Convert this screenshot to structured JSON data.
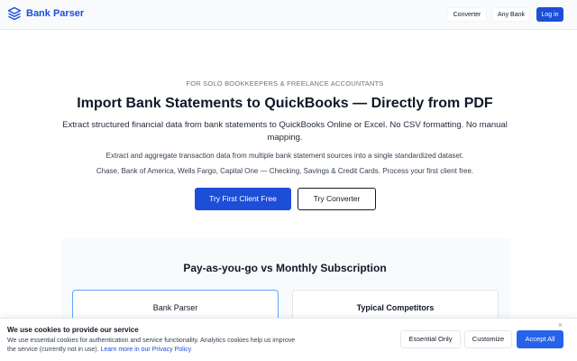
{
  "header": {
    "brand_name": "Bank Parser",
    "nav": {
      "converter": "Converter",
      "any_bank": "Any Bank",
      "login": "Log in"
    }
  },
  "hero": {
    "eyebrow": "FOR SOLO BOOKKEEPERS & FREELANCE ACCOUNTANTS",
    "title": "Import Bank Statements to QuickBooks — Directly from PDF",
    "subtitle": "Extract structured financial data from bank statements to QuickBooks Online or Excel. No CSV formatting. No manual mapping.",
    "line2": "Extract and aggregate transaction data from multiple bank statement sources into a single standardized dataset.",
    "line3": "Chase, Bank of America, Wells Fargo, Capital One — Checking, Savings & Credit Cards. Process your first client free.",
    "cta_primary": "Try First Client Free",
    "cta_secondary": "Try Converter"
  },
  "comparison": {
    "title": "Pay-as-you-go vs Monthly Subscription",
    "cards": [
      {
        "title": "Bank Parser"
      },
      {
        "title": "Typical Competitors"
      }
    ]
  },
  "cookie_banner": {
    "title": "We use cookies to provide our service",
    "text": "We use essential cookies for authentication and service functionality. Analytics cookies help us improve the service (currently not in use).",
    "link": "Learn more in our Privacy Policy",
    "close": "×",
    "essential_only": "Essential Only",
    "customize": "Customize",
    "accept_all": "Accept All"
  },
  "colors": {
    "brand": "#1d4ed8",
    "accent": "#2563eb",
    "surface": "#f8fafc"
  },
  "icons": {
    "brand": "stacked-layers-icon",
    "close": "close-icon"
  }
}
